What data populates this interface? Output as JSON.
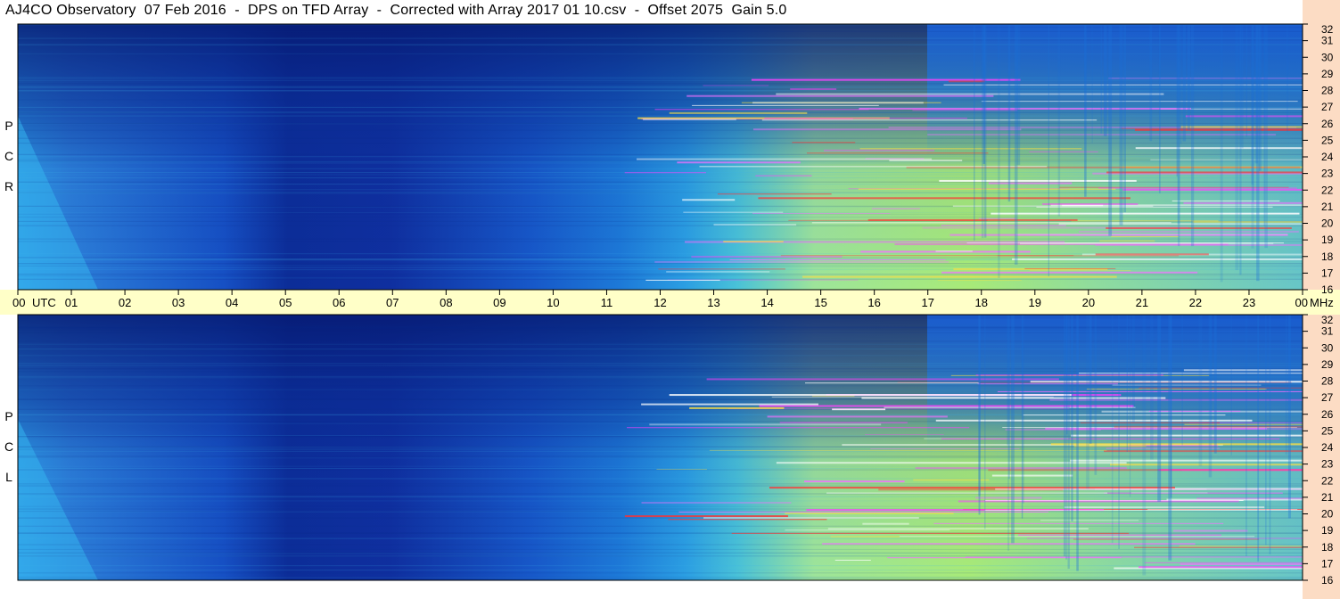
{
  "window": {
    "title": "AJ4CO Observatory  07 Feb 2016  -  DPS on TFD Array  -  Corrected with Array 2017 01 10.csv  -  Offset 2075  Gain 5.0"
  },
  "colors": {
    "background": "#ffffff",
    "time_axis_band": "#ffffc8",
    "freq_axis_band": "#fcdcc4",
    "low_signal": "#0a2a9a",
    "mid_signal": "#1fa8e8",
    "high_signal": "#b8f050",
    "interference": "#ff30ff"
  },
  "chart_data": [
    {
      "type": "heatmap",
      "panel": "upper",
      "polarization": [
        "R",
        "C",
        "P"
      ],
      "x": [
        "00",
        "01",
        "02",
        "03",
        "04",
        "05",
        "06",
        "07",
        "08",
        "09",
        "10",
        "11",
        "12",
        "13",
        "14",
        "15",
        "16",
        "17",
        "18",
        "19",
        "20",
        "21",
        "22",
        "23",
        "00"
      ],
      "x_unit": "UTC",
      "y": [
        "16",
        "17",
        "18",
        "19",
        "20",
        "21",
        "22",
        "23",
        "24",
        "25",
        "26",
        "27",
        "28",
        "29",
        "30",
        "31",
        "32"
      ],
      "y_unit": "MHz",
      "ylim": [
        16,
        32
      ],
      "xlim": [
        0,
        24
      ],
      "colormap": "blue-cyan-yellow"
    },
    {
      "type": "heatmap",
      "panel": "lower",
      "polarization": [
        "L",
        "C",
        "P"
      ],
      "x": [
        "00",
        "01",
        "02",
        "03",
        "04",
        "05",
        "06",
        "07",
        "08",
        "09",
        "10",
        "11",
        "12",
        "13",
        "14",
        "15",
        "16",
        "17",
        "18",
        "19",
        "20",
        "21",
        "22",
        "23",
        "00"
      ],
      "x_unit": "UTC",
      "y": [
        "16",
        "17",
        "18",
        "19",
        "20",
        "21",
        "22",
        "23",
        "24",
        "25",
        "26",
        "27",
        "28",
        "29",
        "30",
        "31",
        "32"
      ],
      "y_unit": "MHz",
      "ylim": [
        16,
        32
      ],
      "xlim": [
        0,
        24
      ],
      "colormap": "blue-cyan-yellow"
    }
  ]
}
